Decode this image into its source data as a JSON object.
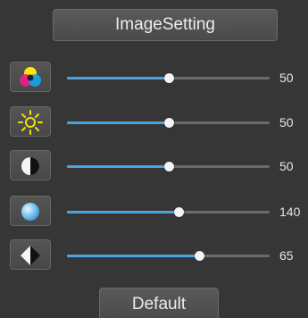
{
  "header": {
    "title": "ImageSetting"
  },
  "sliders": [
    {
      "id": "saturation",
      "icon": "color-wheel-icon",
      "value": "50",
      "min": 0,
      "max": 100,
      "fill_color": "#4da3dd"
    },
    {
      "id": "brightness",
      "icon": "sun-icon",
      "value": "50",
      "min": 0,
      "max": 100,
      "fill_color": "#4da3dd"
    },
    {
      "id": "contrast",
      "icon": "contrast-icon",
      "value": "50",
      "min": 0,
      "max": 100,
      "fill_color": "#4da3dd"
    },
    {
      "id": "hue",
      "icon": "blue-sphere-icon",
      "value": "140",
      "min": 0,
      "max": 255,
      "fill_color": "#4da3dd"
    },
    {
      "id": "sharpness",
      "icon": "sharpness-icon",
      "value": "65",
      "min": 0,
      "max": 100,
      "fill_color": "#4da3dd"
    }
  ],
  "footer": {
    "default_label": "Default"
  },
  "colors": {
    "background": "#363636",
    "accent": "#4da3dd",
    "track": "#6b6b6b",
    "text": "#e6e6e6"
  }
}
